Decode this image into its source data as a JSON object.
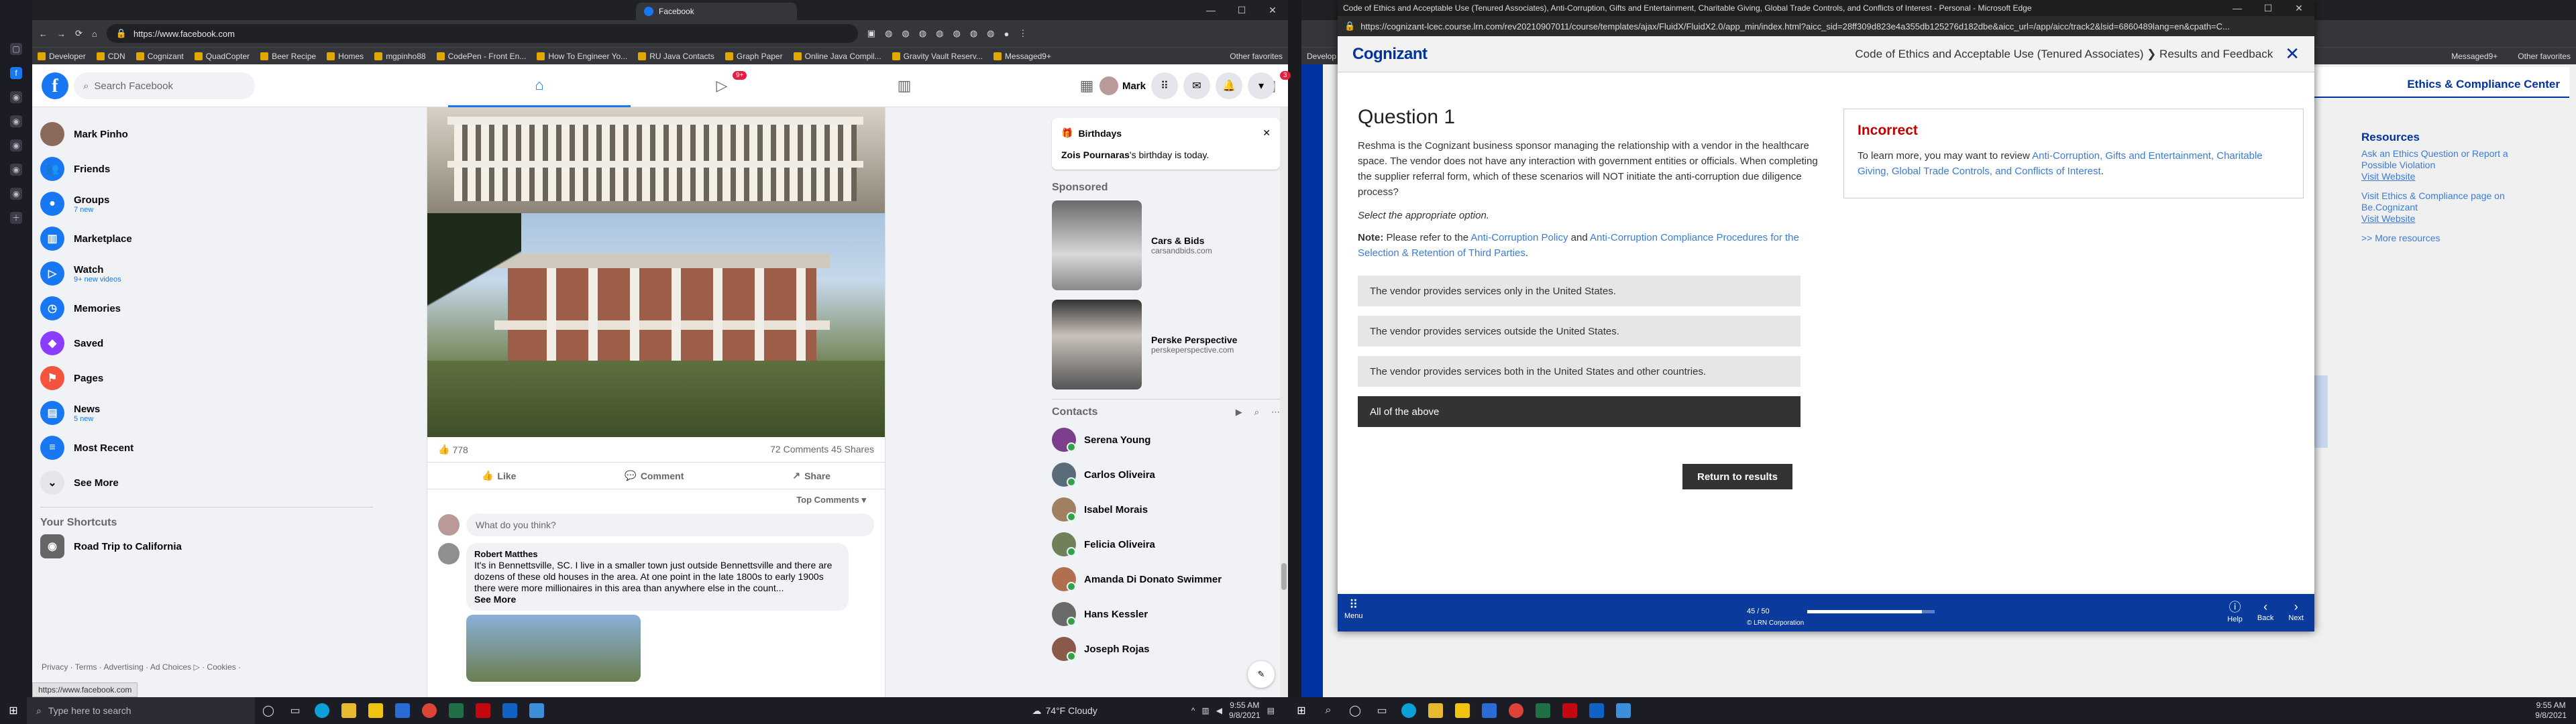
{
  "left_browser": {
    "tab_title": "Facebook",
    "url": "https://www.facebook.com",
    "status_url": "https://www.facebook.com",
    "favorites": [
      "Developer",
      "CDN",
      "Cognizant",
      "QuadCopter",
      "Beer Recipe",
      "Homes",
      "mgpinho88",
      "CodePen - Front En...",
      "How To Engineer Yo...",
      "RU Java Contacts",
      "Graph Paper",
      "Online Java Compil...",
      "Gravity Vault Reserv...",
      "Messaged9+"
    ],
    "other_favorites": "Other favorites"
  },
  "facebook": {
    "search_placeholder": "Search Facebook",
    "watch_badge": "9+",
    "gaming_badge": "3",
    "profile_name": "Mark",
    "left_nav": [
      {
        "label": "Mark Pinho",
        "sub": "",
        "icon": "avatar",
        "color": "#8a6b5b"
      },
      {
        "label": "Friends",
        "sub": "",
        "icon": "friends-icon",
        "color": "#1877f2"
      },
      {
        "label": "Groups",
        "sub": "7 new",
        "icon": "groups-icon",
        "color": "#1877f2"
      },
      {
        "label": "Marketplace",
        "sub": "",
        "icon": "marketplace-icon",
        "color": "#1877f2"
      },
      {
        "label": "Watch",
        "sub": "9+ new videos",
        "icon": "watch-icon",
        "color": "#1877f2"
      },
      {
        "label": "Memories",
        "sub": "",
        "icon": "memories-icon",
        "color": "#1877f2"
      },
      {
        "label": "Saved",
        "sub": "",
        "icon": "saved-icon",
        "color": "#8b3dff"
      },
      {
        "label": "Pages",
        "sub": "",
        "icon": "pages-icon",
        "color": "#f5533d"
      },
      {
        "label": "News",
        "sub": "5 new",
        "icon": "news-icon",
        "color": "#1877f2"
      },
      {
        "label": "Most Recent",
        "sub": "",
        "icon": "recent-icon",
        "color": "#1877f2"
      },
      {
        "label": "See More",
        "sub": "",
        "icon": "chevron-down-icon",
        "color": "#e4e6eb"
      }
    ],
    "shortcuts_title": "Your Shortcuts",
    "shortcut": "Road Trip to California",
    "footer_links": "Privacy · Terms · Advertising · Ad Choices ▷ · Cookies ·",
    "post": {
      "reactions": "778",
      "comments_shares": "72 Comments  45 Shares",
      "like": "Like",
      "comment": "Comment",
      "share": "Share",
      "sort": "Top Comments ▾",
      "comment_placeholder": "What do you think?",
      "commenter": "Robert Matthes",
      "comment_text": "It's in Bennettsville, SC. I live in a smaller town just outside Bennettsville and there are dozens of these old houses in the area. At one point in the late 1800s to early 1900s there were more millionaires in this area than anywhere else in the count...",
      "see_more": "See More"
    },
    "birthdays_title": "Birthdays",
    "birthday_name": "Zois Pournaras",
    "birthday_text": "'s birthday is today.",
    "sponsored_title": "Sponsored",
    "sponsored": [
      {
        "title": "Cars & Bids",
        "site": "carsandbids.com"
      },
      {
        "title": "Perske Perspective",
        "site": "perskeperspective.com"
      }
    ],
    "contacts_title": "Contacts",
    "contacts": [
      "Serena Young",
      "Carlos Oliveira",
      "Isabel Morais",
      "Felicia Oliveira",
      "Amanda Di Donato Swimmer",
      "Hans Kessler",
      "Joseph Rojas"
    ]
  },
  "edge": {
    "title": "Code of Ethics and Acceptable Use (Tenured Associates), Anti-Corruption, Gifts and Entertainment, Charitable Giving, Global Trade Controls, and Conflicts of Interest - Personal - Microsoft Edge",
    "url": "https://cognizant-lcec.course.lrn.com/rev20210907011/course/templates/ajax/FluidX/FluidX2.0/app_min/index.html?aicc_sid=28ff309d823e4a355db125276d182dbe&aicc_url=/app/aicc/track2&lsid=6860489lang=en&cpath=C...",
    "logo": "Cognizant",
    "breadcrumb": "Code of Ethics and Acceptable Use (Tenured Associates) ❯ Results and Feedback",
    "question_title": "Question 1",
    "question_text": "Reshma is the Cognizant business sponsor managing the relationship with a vendor in the healthcare space. The vendor does not have any interaction with government entities or officials. When completing the supplier referral form, which of these scenarios will NOT initiate the anti-corruption due diligence process?",
    "instruction": "Select the appropriate option.",
    "note_label": "Note:",
    "note_pre": "Please refer to the",
    "note_link1": "Anti-Corruption Policy",
    "note_and": "and",
    "note_link2": "Anti-Corruption Compliance Procedures for the Selection & Retention of Third Parties",
    "note_end": ".",
    "options": [
      "The vendor provides services only in the United States.",
      "The vendor provides services outside the United States.",
      "The vendor provides services both in the United States and other countries.",
      "All of the above"
    ],
    "return_button": "Return to results",
    "feedback_title": "Incorrect",
    "feedback_pre": "To learn more, you may want to review",
    "feedback_link": "Anti-Corruption, Gifts and Entertainment, Charitable Giving, Global Trade Controls, and Conflicts of Interest",
    "feedback_end": ".",
    "footer_menu": "Menu",
    "progress_text": "45 / 50",
    "progress": 0.9,
    "copyright": "© LRN Corporation",
    "help": "Help",
    "back": "Back",
    "next": "Next"
  },
  "right_bg": {
    "site_title": "Ethics & Compliance Center",
    "resources_title": "Resources",
    "link1": "Ask an Ethics Question or Report a Possible Violation",
    "link1b": "Visit Website",
    "link2": "Visit Ethics & Compliance page on Be.Cognizant",
    "link2b": "Visit Website",
    "more": ">> More resources",
    "favorites_fragment": "Develop",
    "messaged": "Messaged9+",
    "other_favorites": "Other favorites"
  },
  "taskbar": {
    "search_placeholder": "Type here to search",
    "weather": "74°F  Cloudy",
    "time1": "9:55 AM",
    "date1": "9/8/2021",
    "time2": "9:55 AM",
    "date2": "9/8/2021"
  }
}
